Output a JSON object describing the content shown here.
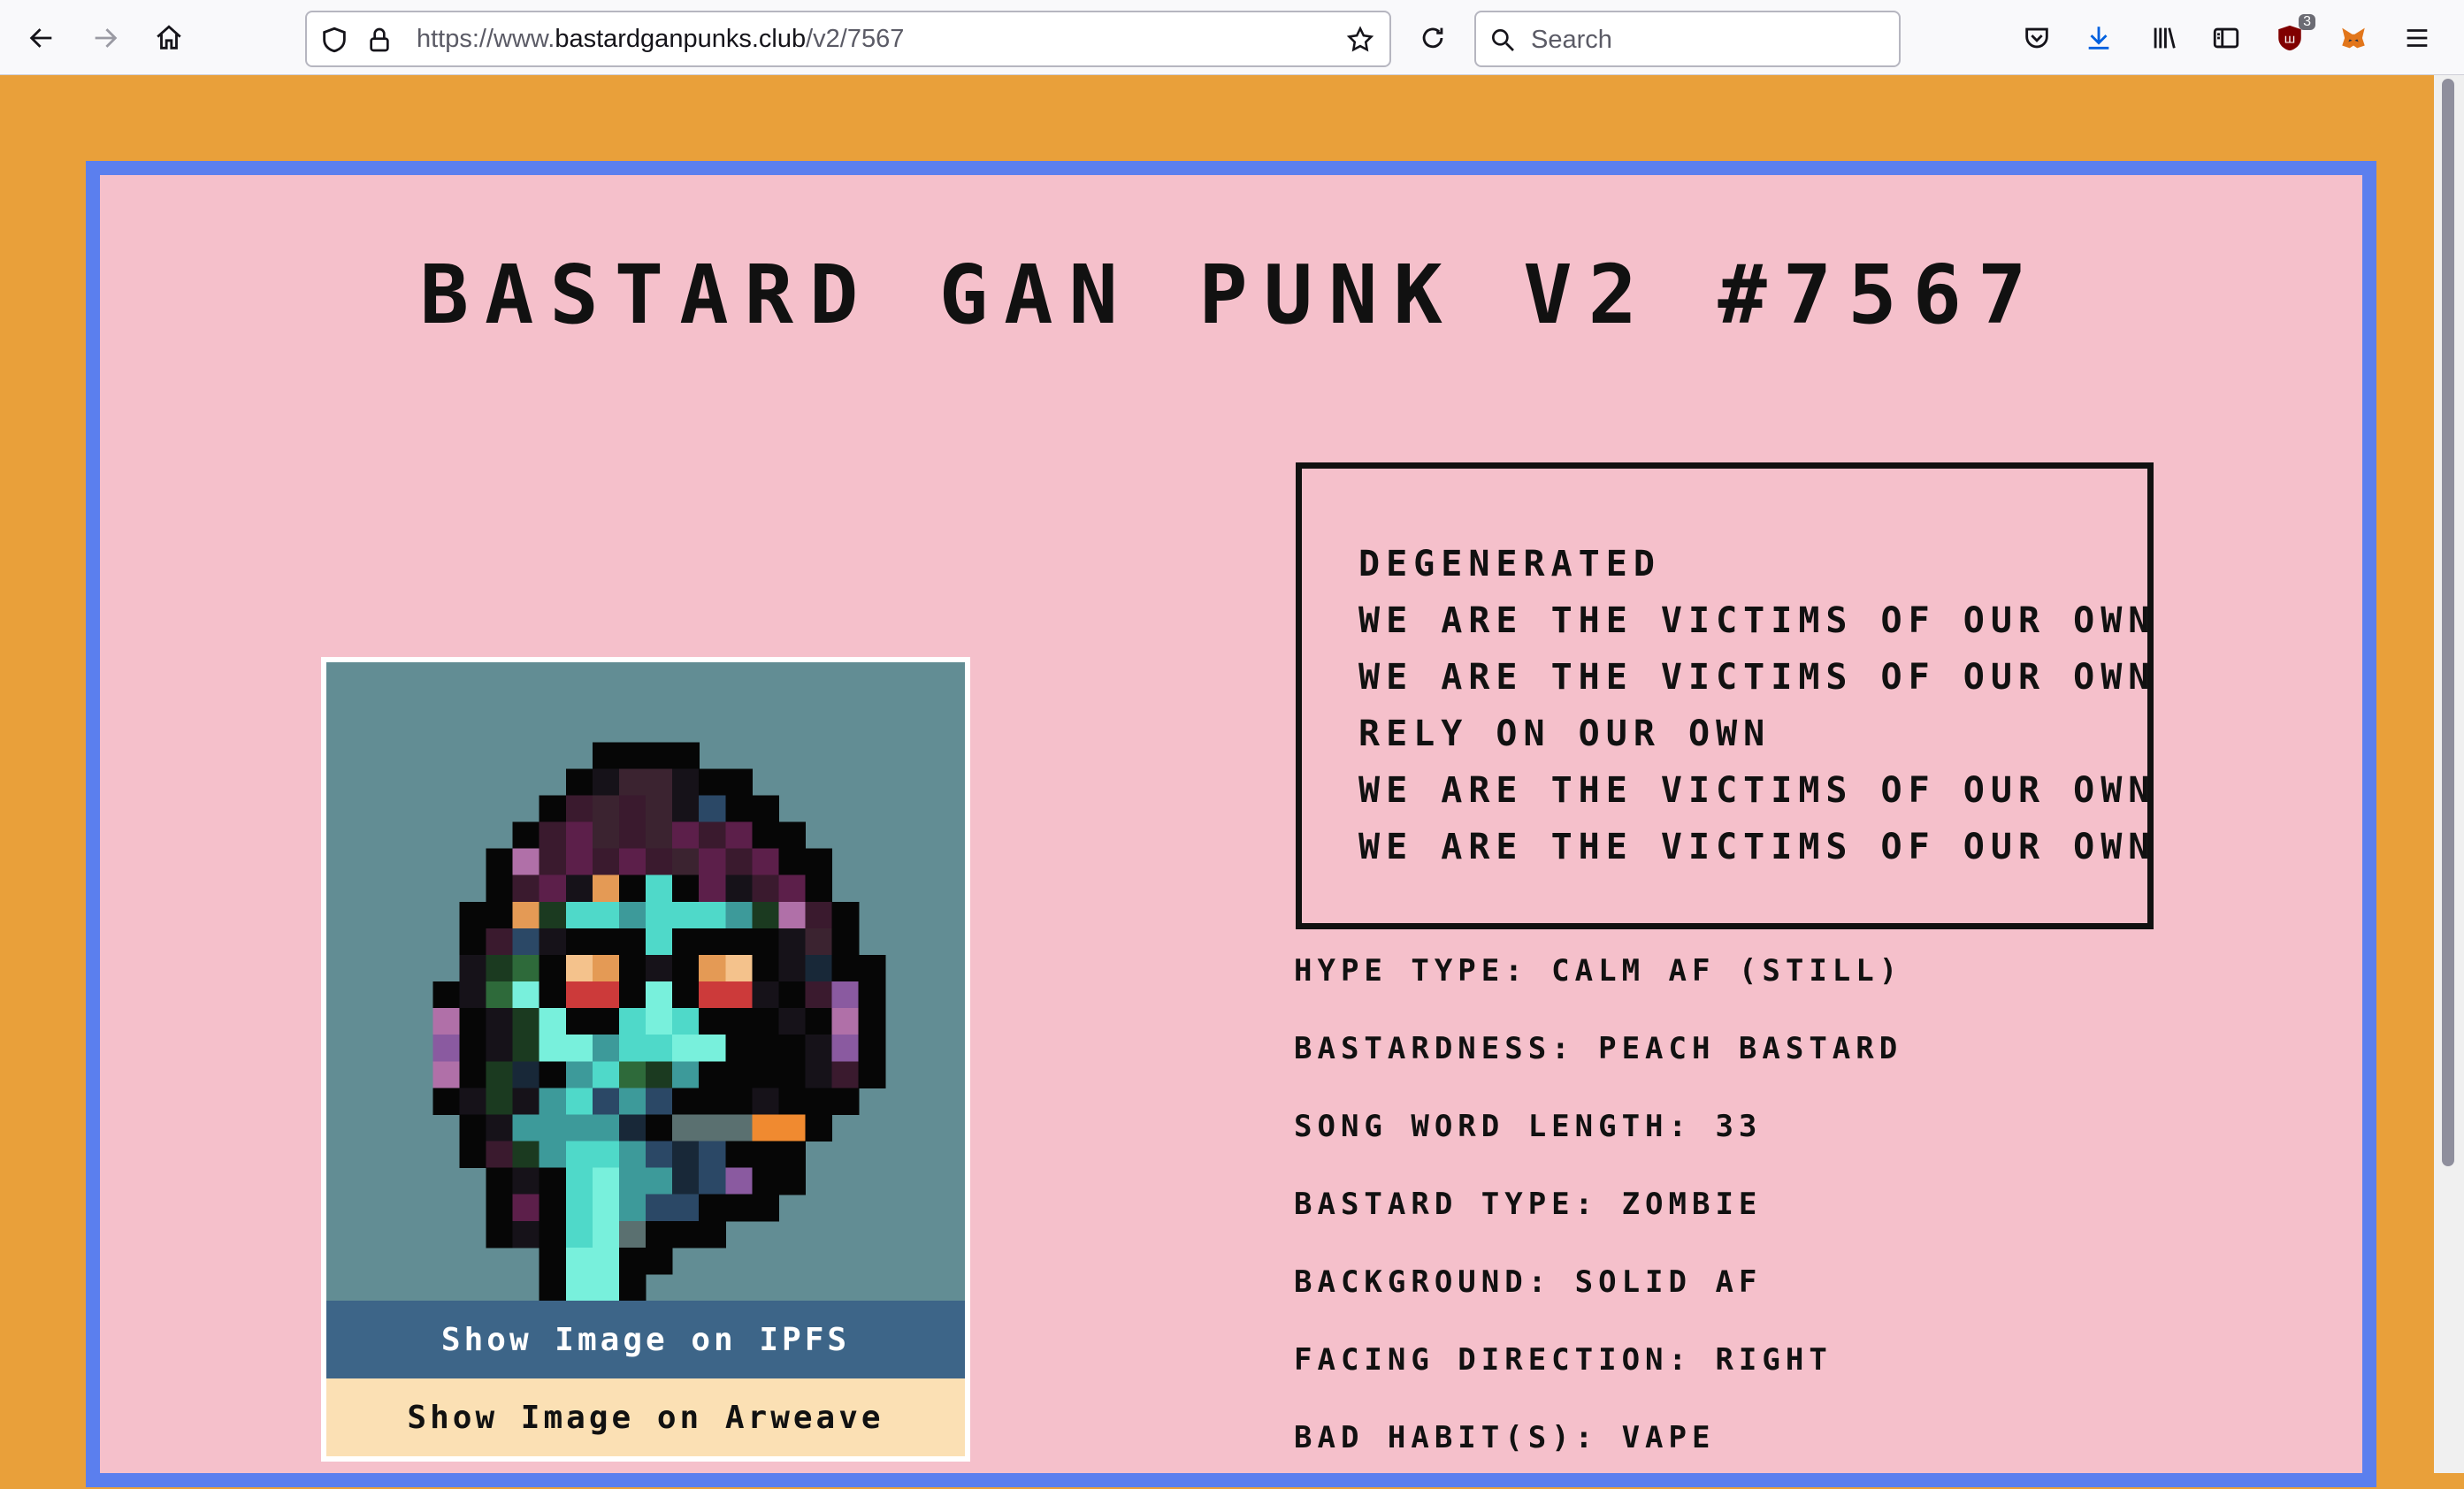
{
  "browser": {
    "url_prefix": "https://www.",
    "url_host": "bastardganpunks.club",
    "url_path": "/v2/7567",
    "search_placeholder": "Search",
    "extension_badge": "3"
  },
  "page": {
    "title": "BASTARD GAN PUNK V2 #7567",
    "lyrics": [
      "DEGENERATED",
      "WE ARE THE VICTIMS OF OUR OWN",
      "WE ARE THE VICTIMS OF OUR OWN",
      "RELY ON OUR OWN",
      "WE ARE THE VICTIMS OF OUR OWN",
      "WE ARE THE VICTIMS OF OUR OWN"
    ],
    "attributes": [
      "HYPE TYPE: CALM AF (STILL)",
      "BASTARDNESS: PEACH BASTARD",
      "SONG WORD LENGTH: 33",
      "BASTARD TYPE: ZOMBIE",
      "BACKGROUND: SOLID AF",
      "FACING DIRECTION: RIGHT",
      "BAD HABIT(S): VAPE"
    ],
    "buttons": {
      "ipfs": "Show Image on IPFS",
      "arweave": "Show Image on Arweave"
    }
  },
  "colors": {
    "page_bg": "#e9a03a",
    "frame_border": "#5b7fee",
    "frame_bg": "#f5c0cb",
    "punk_bg": "#628d94",
    "ipfs_btn": "#3d6588",
    "arweave_btn": "#fbe0b4"
  }
}
